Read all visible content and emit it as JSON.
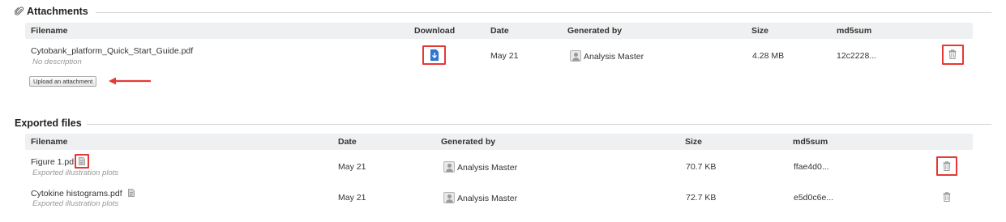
{
  "attachments": {
    "title": "Attachments",
    "columns": {
      "filename": "Filename",
      "download": "Download",
      "date": "Date",
      "generated_by": "Generated by",
      "size": "Size",
      "md5sum": "md5sum"
    },
    "rows": [
      {
        "filename": "Cytobank_platform_Quick_Start_Guide.pdf",
        "description": "No description",
        "date": "May 21",
        "generated_by": "Analysis Master",
        "size": "4.28 MB",
        "md5sum": "12c2228..."
      }
    ],
    "upload_button_label": "Upload an attachment"
  },
  "exported_files": {
    "title": "Exported files",
    "columns": {
      "filename": "Filename",
      "date": "Date",
      "generated_by": "Generated by",
      "size": "Size",
      "md5sum": "md5sum"
    },
    "rows": [
      {
        "filename": "Figure 1.pd",
        "description": "Exported illustration plots",
        "date": "May 21",
        "generated_by": "Analysis Master",
        "size": "70.7 KB",
        "md5sum": "ffae4d0..."
      },
      {
        "filename": "Cytokine histograms.pdf",
        "description": "Exported illustration plots",
        "date": "May 21",
        "generated_by": "Analysis Master",
        "size": "72.7 KB",
        "md5sum": "e5d0c6e..."
      }
    ]
  },
  "colors": {
    "highlight": "#e53935",
    "download_icon": "#2e77d0",
    "header_bg": "#eef0f2"
  }
}
